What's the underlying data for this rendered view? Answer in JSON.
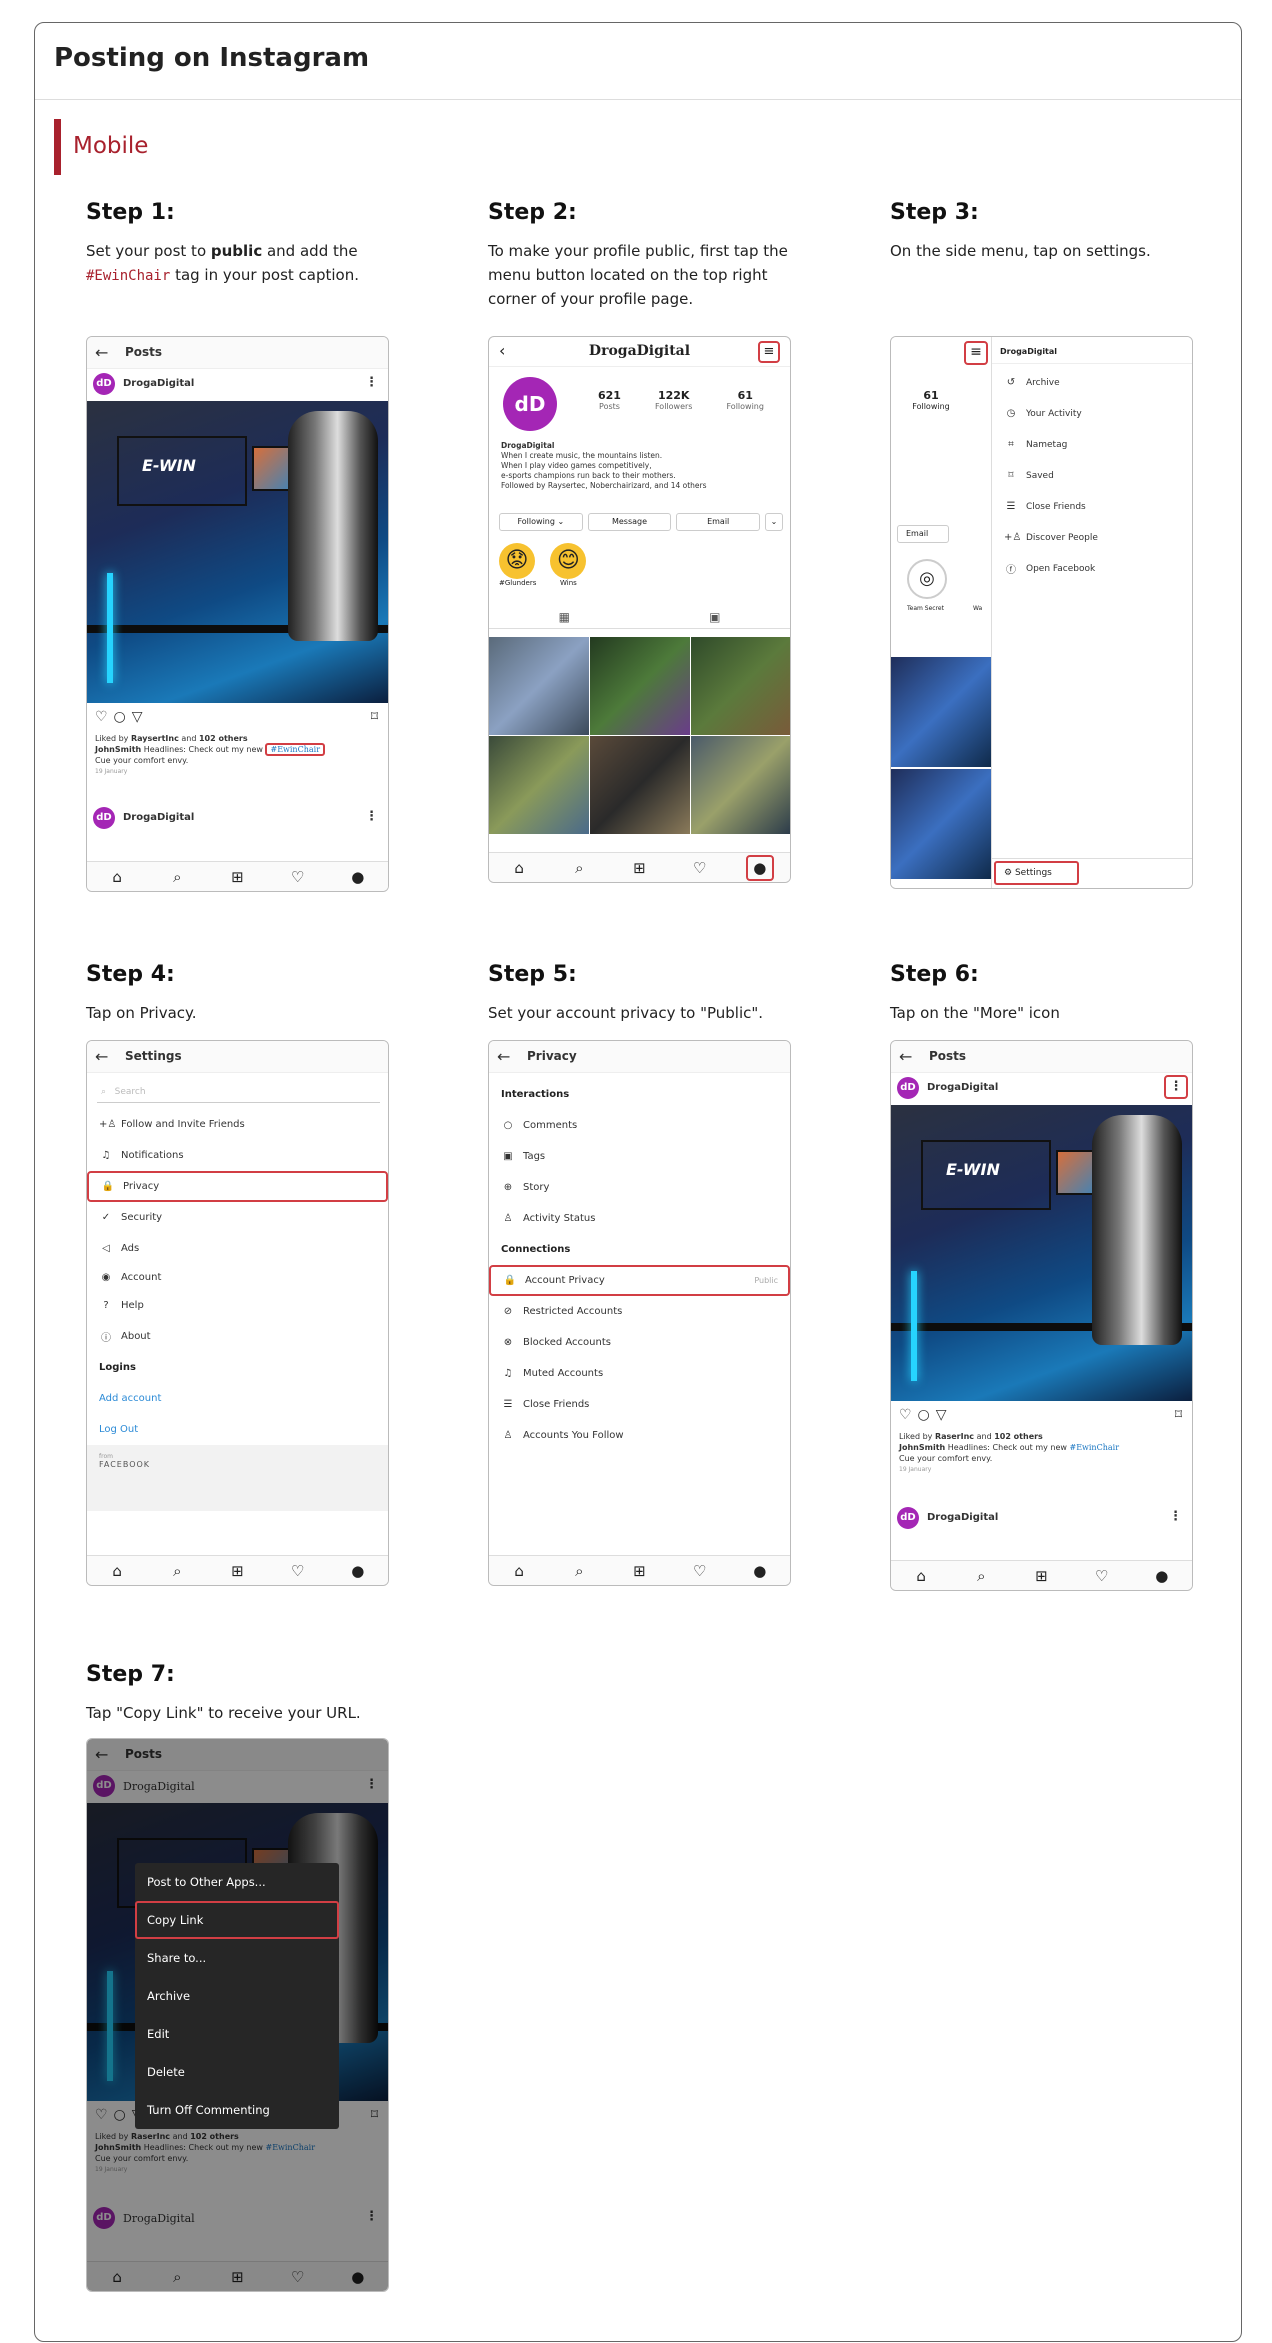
{
  "header": {
    "title": "Posting on Instagram",
    "section": "Mobile"
  },
  "steps": [
    {
      "title": "Step 1:",
      "desc_before": "Set your post to ",
      "desc_bold": "public",
      "desc_mid": " and add the ",
      "desc_tag": "#EwinChair",
      "desc_after": " tag in your post caption."
    },
    {
      "title": "Step 2:",
      "desc": "To make your profile public, first tap the menu button located on the top right corner of your profile page."
    },
    {
      "title": "Step 3:",
      "desc": "On the side menu, tap on settings."
    },
    {
      "title": "Step 4:",
      "desc": "Tap on Privacy."
    },
    {
      "title": "Step 5:",
      "desc": "Set your account privacy to \"Public\"."
    },
    {
      "title": "Step 6:",
      "desc": "Tap on the \"More\" icon"
    },
    {
      "title": "Step 7:",
      "desc": "Tap \"Copy Link\" to receive your URL."
    }
  ],
  "post": {
    "screen_title": "Posts",
    "account": "DrogaDigital",
    "avatar_text": "dD",
    "photo_logo": "E-WIN",
    "liked_prefix": "Liked by ",
    "liked_user": "RaysertInc",
    "liked_user_alt": "RaserInc",
    "liked_and": " and ",
    "liked_others": "102 others",
    "caption_user": "JohnSmith",
    "caption_text": " Headlines: Check out my new ",
    "hashtag": "#EwinChair",
    "caption_line2": "Cue your comfort envy.",
    "date": "19 January"
  },
  "profile": {
    "name": "DrogaDigital",
    "posts_count": "621",
    "posts_label": "Posts",
    "followers_count": "122K",
    "followers_label": "Followers",
    "following_count": "61",
    "following_label": "Following",
    "bio_name": "DrogaDigital",
    "bio_line1": "When I create music, the mountains listen.",
    "bio_line2": "When I play video games competitively,",
    "bio_line3": "e-sports champions run back to their mothers.",
    "followed_by": "Followed by Raysertec, Noberchairizard, and 14 others",
    "btn_following": "Following",
    "btn_message": "Message",
    "btn_email": "Email",
    "highlight1": "#Glunders",
    "highlight2": "Wins",
    "highlight1_emoji": "😟",
    "highlight2_emoji": "😊"
  },
  "sidemenu": {
    "account": "DrogaDigital",
    "following_count": "61",
    "following_label": "Following",
    "email_btn": "Email",
    "story1": "Team Secret",
    "story2": "Wa",
    "items": [
      "Archive",
      "Your Activity",
      "Nametag",
      "Saved",
      "Close Friends",
      "Discover People",
      "Open Facebook"
    ],
    "settings": "Settings"
  },
  "settings": {
    "title": "Settings",
    "search_placeholder": "Search",
    "items": [
      "Follow and Invite Friends",
      "Notifications",
      "Privacy",
      "Security",
      "Ads",
      "Account",
      "Help",
      "About"
    ],
    "logins": "Logins",
    "add_account": "Add account",
    "log_out": "Log Out",
    "from": "from",
    "facebook": "FACEBOOK"
  },
  "privacy": {
    "title": "Privacy",
    "interactions": "Interactions",
    "items1": [
      "Comments",
      "Tags",
      "Story",
      "Activity Status"
    ],
    "connections": "Connections",
    "account_privacy": "Account Privacy",
    "account_privacy_value": "Public",
    "items2": [
      "Restricted Accounts",
      "Blocked Accounts",
      "Muted Accounts",
      "Close Friends",
      "Accounts You Follow"
    ]
  },
  "more_menu": {
    "items": [
      "Post to Other Apps...",
      "Copy Link",
      "Share to...",
      "Archive",
      "Edit",
      "Delete",
      "Turn Off Commenting"
    ]
  },
  "nav_icons": [
    "home-icon",
    "search-icon",
    "add-icon",
    "heart-icon",
    "profile-icon"
  ],
  "colors": {
    "accent": "#a8212d",
    "highlight_box": "#d23e44",
    "avatar": "#a426b5",
    "link": "#2b8ad6"
  }
}
